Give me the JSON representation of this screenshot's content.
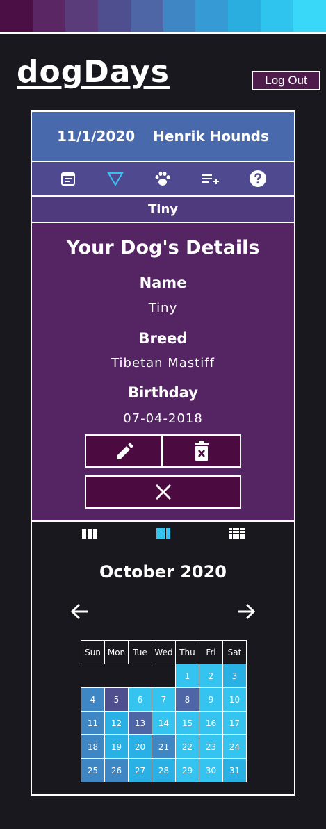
{
  "top_strip": [
    "#4b0f45",
    "#5a2663",
    "#5a3c7a",
    "#4f4f8f",
    "#4e65a6",
    "#3f86c4",
    "#369bd4",
    "#2aaee0",
    "#2ec4ee",
    "#3ad8f8"
  ],
  "app": {
    "logo": "dogDays",
    "logout_label": "Log Out"
  },
  "header": {
    "date": "11/1/2020",
    "user_name": "Henrik Hounds"
  },
  "nav_icons": [
    "calendar-icon",
    "filter-icon",
    "paw-icon",
    "add-list-icon",
    "help-icon"
  ],
  "selected_dog": "Tiny",
  "details": {
    "title": "Your Dog's Details",
    "name_label": "Name",
    "name_value": "Tiny",
    "breed_label": "Breed",
    "breed_value": "Tibetan Mastiff",
    "birthday_label": "Birthday",
    "birthday_value": "07-04-2018"
  },
  "view_icons": [
    "three-column-view-icon",
    "grid-view-icon",
    "dense-grid-view-icon"
  ],
  "calendar": {
    "month_label": "October 2020",
    "weekdays": [
      "Sun",
      "Mon",
      "Tue",
      "Wed",
      "Thu",
      "Fri",
      "Sat"
    ],
    "leading_blanks": 4,
    "days": [
      {
        "d": "1",
        "c": "#35c3f0"
      },
      {
        "d": "2",
        "c": "#35c3f0"
      },
      {
        "d": "3",
        "c": "#29b0e4"
      },
      {
        "d": "4",
        "c": "#3f86c4"
      },
      {
        "d": "5",
        "c": "#4f4f8f"
      },
      {
        "d": "6",
        "c": "#35c3f0"
      },
      {
        "d": "7",
        "c": "#35c3f0"
      },
      {
        "d": "8",
        "c": "#4e65a6"
      },
      {
        "d": "9",
        "c": "#35c3f0"
      },
      {
        "d": "10",
        "c": "#35c3f0"
      },
      {
        "d": "11",
        "c": "#3f86c4"
      },
      {
        "d": "12",
        "c": "#29b0e4"
      },
      {
        "d": "13",
        "c": "#4e65a6"
      },
      {
        "d": "14",
        "c": "#35c3f0"
      },
      {
        "d": "15",
        "c": "#35c3f0"
      },
      {
        "d": "16",
        "c": "#35c3f0"
      },
      {
        "d": "17",
        "c": "#35c3f0"
      },
      {
        "d": "18",
        "c": "#3f86c4"
      },
      {
        "d": "19",
        "c": "#29b0e4"
      },
      {
        "d": "20",
        "c": "#29b0e4"
      },
      {
        "d": "21",
        "c": "#3f86c4"
      },
      {
        "d": "22",
        "c": "#35c3f0"
      },
      {
        "d": "23",
        "c": "#35c3f0"
      },
      {
        "d": "24",
        "c": "#35c3f0"
      },
      {
        "d": "25",
        "c": "#3f86c4"
      },
      {
        "d": "26",
        "c": "#3f86c4"
      },
      {
        "d": "27",
        "c": "#29b0e4"
      },
      {
        "d": "28",
        "c": "#29b0e4"
      },
      {
        "d": "29",
        "c": "#35c3f0"
      },
      {
        "d": "30",
        "c": "#35c3f0"
      },
      {
        "d": "31",
        "c": "#29b0e4"
      }
    ]
  }
}
